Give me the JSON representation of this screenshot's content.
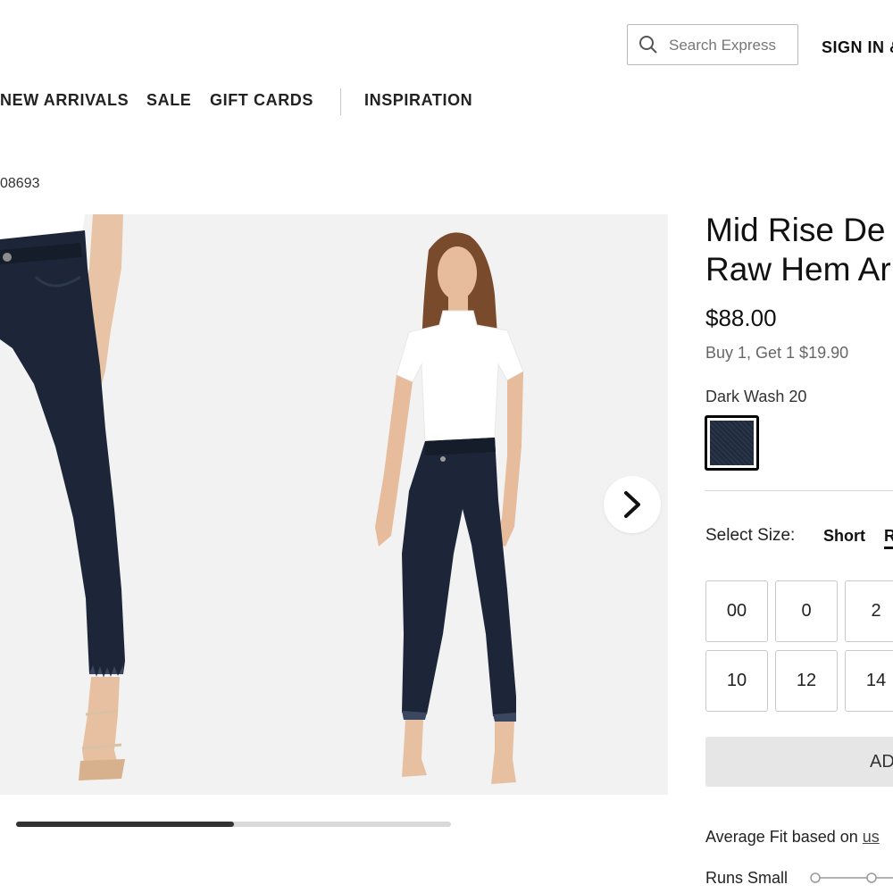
{
  "header": {
    "search_placeholder": "Search Express",
    "sign_in_label": "SIGN IN &"
  },
  "nav": {
    "items": [
      "NEW ARRIVALS",
      "SALE",
      "GIFT CARDS",
      "INSPIRATION"
    ]
  },
  "breadcrumb": {
    "item_number": "08693"
  },
  "gallery": {
    "scroll_progress": 0.5,
    "next_icon": "chevron-right-icon"
  },
  "product": {
    "title_line1": "Mid Rise De",
    "title_line2": "Raw Hem Ar",
    "price": "$88.00",
    "promo": "Buy 1, Get 1 $19.90",
    "color_name": "Dark Wash 20",
    "swatch_color": "#1f2a3d",
    "size_label": "Select Size:",
    "length_options": [
      "Short",
      "R"
    ],
    "selected_length": "R",
    "sizes_row1": [
      "00",
      "0",
      "2"
    ],
    "sizes_row2": [
      "10",
      "12",
      "14"
    ],
    "add_to_bag_label": "AD",
    "fit_text": "Average Fit based on ",
    "fit_link": "us",
    "runs_small": "Runs Small"
  }
}
